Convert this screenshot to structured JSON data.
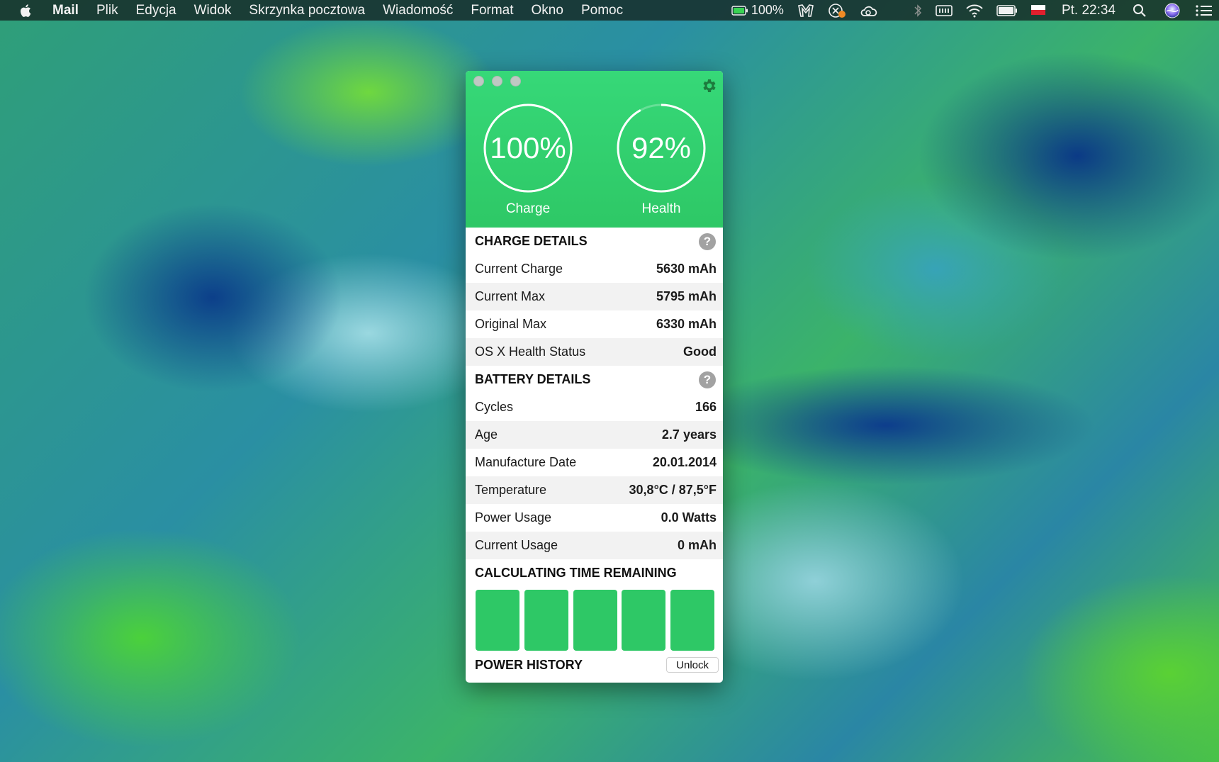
{
  "menubar": {
    "app_name": "Mail",
    "items": [
      "Plik",
      "Edycja",
      "Widok",
      "Skrzynka pocztowa",
      "Wiadomość",
      "Format",
      "Okno",
      "Pomoc"
    ],
    "battery_percent": "100%",
    "clock": "Pt. 22:34",
    "icons": [
      "battery-icon",
      "status-icon",
      "app-status-icon",
      "creative-cloud-icon",
      "bluetooth-icon",
      "memory-icon",
      "wifi-icon",
      "battery-level-icon",
      "flag-icon",
      "search-icon",
      "siri-icon",
      "notification-list-icon"
    ]
  },
  "window": {
    "gauges": {
      "charge": {
        "value": "100%",
        "label": "Charge",
        "level": 1.0
      },
      "health": {
        "value": "92%",
        "label": "Health",
        "level": 0.92
      }
    },
    "charge_details": {
      "title": "CHARGE DETAILS",
      "rows": [
        {
          "label": "Current Charge",
          "value": "5630 mAh"
        },
        {
          "label": "Current Max",
          "value": "5795 mAh"
        },
        {
          "label": "Original Max",
          "value": "6330 mAh"
        },
        {
          "label": "OS X Health Status",
          "value": "Good"
        }
      ]
    },
    "battery_details": {
      "title": "BATTERY DETAILS",
      "rows": [
        {
          "label": "Cycles",
          "value": "166"
        },
        {
          "label": "Age",
          "value": "2.7 years"
        },
        {
          "label": "Manufacture Date",
          "value": "20.01.2014"
        },
        {
          "label": "Temperature",
          "value": "30,8°C / 87,5°F"
        },
        {
          "label": "Power Usage",
          "value": "0.0 Watts"
        },
        {
          "label": "Current Usage",
          "value": "0 mAh"
        }
      ]
    },
    "time_remaining_title": "CALCULATING TIME REMAINING",
    "power_history_title": "POWER HISTORY",
    "unlock_label": "Unlock",
    "help_symbol": "?",
    "colors": {
      "accent": "#2ec866",
      "header_top": "#36d878"
    }
  }
}
